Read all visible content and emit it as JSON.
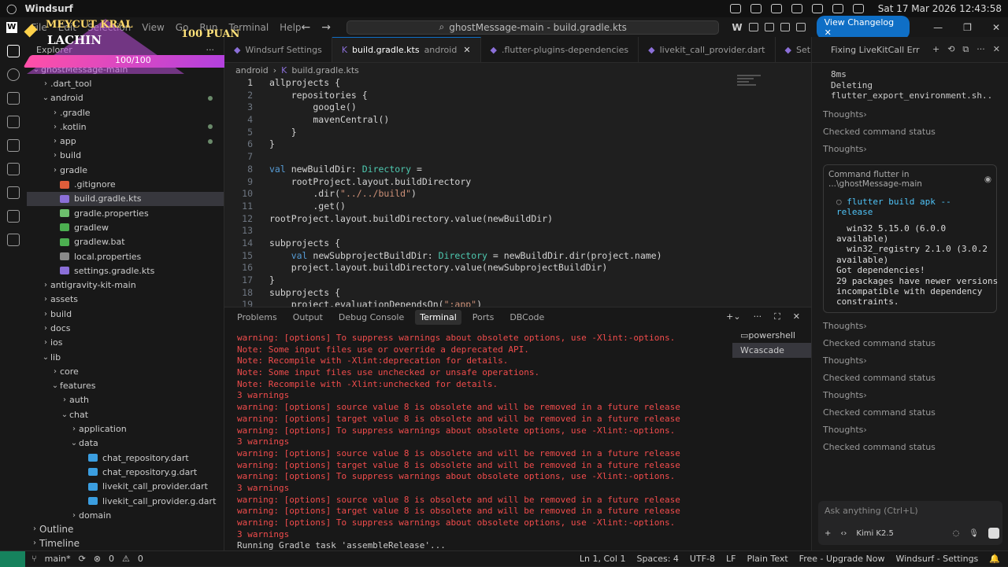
{
  "system": {
    "app": "Windsurf",
    "clock": "Sat 17 Mar 2026 12:43:58"
  },
  "titlebar": {
    "menu": [
      "File",
      "Edit",
      "Selection",
      "View",
      "Go",
      "Run",
      "Terminal",
      "Help"
    ],
    "search": "ghostMessage-main - build.gradle.kts",
    "changelog": "View Changelog"
  },
  "overlay": {
    "name1": "MEYCUT KRAL",
    "name2": "LACHIN",
    "points": "100 PUAN",
    "hp": "100/100"
  },
  "sidebar": {
    "title": "Explorer",
    "root": "ghostMessage-main",
    "items": [
      {
        "label": ".dart_tool",
        "depth": 1,
        "type": "folder",
        "arrow": "›"
      },
      {
        "label": "android",
        "depth": 1,
        "type": "folder",
        "arrow": "⌄",
        "mod": true
      },
      {
        "label": ".gradle",
        "depth": 2,
        "type": "folder",
        "arrow": "›"
      },
      {
        "label": ".kotlin",
        "depth": 2,
        "type": "folder",
        "arrow": "›",
        "mod": true
      },
      {
        "label": "app",
        "depth": 2,
        "type": "folder",
        "arrow": "›",
        "mod": true
      },
      {
        "label": "build",
        "depth": 2,
        "type": "folder",
        "arrow": "›"
      },
      {
        "label": "gradle",
        "depth": 2,
        "type": "folder",
        "arrow": "›"
      },
      {
        "label": ".gitignore",
        "depth": 2,
        "type": "git",
        "arrow": ""
      },
      {
        "label": "build.gradle.kts",
        "depth": 2,
        "type": "kts",
        "arrow": "",
        "sel": true
      },
      {
        "label": "gradle.properties",
        "depth": 2,
        "type": "prop",
        "arrow": ""
      },
      {
        "label": "gradlew",
        "depth": 2,
        "type": "gw",
        "arrow": ""
      },
      {
        "label": "gradlew.bat",
        "depth": 2,
        "type": "gw",
        "arrow": ""
      },
      {
        "label": "local.properties",
        "depth": 2,
        "type": "locp",
        "arrow": ""
      },
      {
        "label": "settings.gradle.kts",
        "depth": 2,
        "type": "kts",
        "arrow": ""
      },
      {
        "label": "antigravity-kit-main",
        "depth": 1,
        "type": "folder",
        "arrow": "›"
      },
      {
        "label": "assets",
        "depth": 1,
        "type": "folder",
        "arrow": "›"
      },
      {
        "label": "build",
        "depth": 1,
        "type": "folder",
        "arrow": "›"
      },
      {
        "label": "docs",
        "depth": 1,
        "type": "folder",
        "arrow": "›"
      },
      {
        "label": "ios",
        "depth": 1,
        "type": "folder",
        "arrow": "›"
      },
      {
        "label": "lib",
        "depth": 1,
        "type": "folder",
        "arrow": "⌄"
      },
      {
        "label": "core",
        "depth": 2,
        "type": "folder",
        "arrow": "›"
      },
      {
        "label": "features",
        "depth": 2,
        "type": "folder",
        "arrow": "⌄"
      },
      {
        "label": "auth",
        "depth": 3,
        "type": "folder",
        "arrow": "›"
      },
      {
        "label": "chat",
        "depth": 3,
        "type": "folder",
        "arrow": "⌄"
      },
      {
        "label": "application",
        "depth": 4,
        "type": "folder",
        "arrow": "›"
      },
      {
        "label": "data",
        "depth": 4,
        "type": "folder",
        "arrow": "⌄"
      },
      {
        "label": "chat_repository.dart",
        "depth": 5,
        "type": "dart",
        "arrow": ""
      },
      {
        "label": "chat_repository.g.dart",
        "depth": 5,
        "type": "dart",
        "arrow": ""
      },
      {
        "label": "livekit_call_provider.dart",
        "depth": 5,
        "type": "dart",
        "arrow": ""
      },
      {
        "label": "livekit_call_provider.g.dart",
        "depth": 5,
        "type": "dart",
        "arrow": ""
      },
      {
        "label": "domain",
        "depth": 4,
        "type": "folder",
        "arrow": "›"
      }
    ],
    "outline": "Outline",
    "timeline": "Timeline"
  },
  "editor": {
    "tabs": [
      {
        "label": "Windsurf Settings",
        "active": false
      },
      {
        "label": "build.gradle.kts",
        "suffix": "android",
        "active": true
      },
      {
        "label": ".flutter-plugins-dependencies",
        "active": false
      },
      {
        "label": "livekit_call_provider.dart",
        "active": false
      },
      {
        "label": "Set",
        "active": false
      }
    ],
    "crumb1": "android",
    "crumb2": "build.gradle.kts",
    "lines": [
      "allprojects {",
      "    repositories {",
      "        google()",
      "        mavenCentral()",
      "    }",
      "}",
      "",
      "val newBuildDir: Directory =",
      "    rootProject.layout.buildDirectory",
      "        .dir(\"../../build\")",
      "        .get()",
      "rootProject.layout.buildDirectory.value(newBuildDir)",
      "",
      "subprojects {",
      "    val newSubprojectBuildDir: Directory = newBuildDir.dir(project.name)",
      "    project.layout.buildDirectory.value(newSubprojectBuildDir)",
      "}",
      "subprojects {",
      "    project.evaluationDependsOn(\":app\")"
    ]
  },
  "panel": {
    "tabs": [
      "Problems",
      "Output",
      "Debug Console",
      "Terminal",
      "Ports",
      "DBCode"
    ],
    "active": "Terminal",
    "sessions": [
      "powershell",
      "cascade"
    ],
    "lines": [
      "warning: [options] To suppress warnings about obsolete options, use -Xlint:-options.",
      "Note: Some input files use or override a deprecated API.",
      "Note: Recompile with -Xlint:deprecation for details.",
      "Note: Some input files use unchecked or unsafe operations.",
      "Note: Recompile with -Xlint:unchecked for details.",
      "3 warnings",
      "warning: [options] source value 8 is obsolete and will be removed in a future release",
      "warning: [options] target value 8 is obsolete and will be removed in a future release",
      "warning: [options] To suppress warnings about obsolete options, use -Xlint:-options.",
      "3 warnings",
      "warning: [options] source value 8 is obsolete and will be removed in a future release",
      "warning: [options] target value 8 is obsolete and will be removed in a future release",
      "warning: [options] To suppress warnings about obsolete options, use -Xlint:-options.",
      "3 warnings",
      "warning: [options] source value 8 is obsolete and will be removed in a future release",
      "warning: [options] target value 8 is obsolete and will be removed in a future release",
      "warning: [options] To suppress warnings about obsolete options, use -Xlint:-options.",
      "3 warnings",
      "Running Gradle task 'assembleRelease'..."
    ]
  },
  "chat": {
    "title": "Fixing LiveKitCall Err",
    "top_out": "8ms\nDeleting\nflutter_export_environment.sh..",
    "items1": [
      "Thoughts",
      "Checked command status",
      "Thoughts"
    ],
    "cmd_header": "Command flutter in ...\\ghostMessage-main",
    "cmd": "flutter build apk --release",
    "cmd_out": "  win32 5.15.0 (6.0.0\navailable)\n  win32_registry 2.1.0 (3.0.2\navailable)\nGot dependencies!\n29 packages have newer versions\nincompatible with dependency\nconstraints.",
    "items2": [
      "Thoughts",
      "Checked command status",
      "Thoughts",
      "Checked command status",
      "Thoughts",
      "Checked command status",
      "Thoughts",
      "Checked command status"
    ],
    "ask_placeholder": "Ask anything (Ctrl+L)",
    "model": "Kimi K2.5"
  },
  "status": {
    "branch": "main*",
    "errors": "0",
    "warnings": "0",
    "pos": "Ln 1, Col 1",
    "spaces": "Spaces: 4",
    "enc": "UTF-8",
    "eol": "LF",
    "lang": "Plain Text",
    "upgrade": "Free - Upgrade Now",
    "settings": "Windsurf - Settings"
  }
}
